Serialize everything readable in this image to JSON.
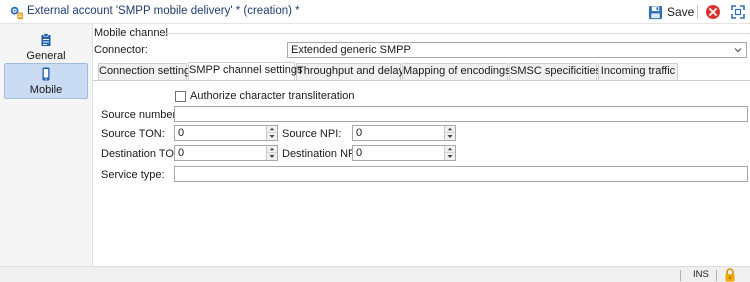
{
  "window": {
    "title": "External account 'SMPP mobile delivery' * (creation) *",
    "save_label": "Save",
    "icons": [
      "app-gear-icon",
      "save-disk-icon",
      "close-circle-icon",
      "expand-icon"
    ],
    "accent_color": "#1f3d73"
  },
  "sidebar": {
    "items": [
      {
        "label": "General",
        "icon": "document-icon",
        "selected": false
      },
      {
        "label": "Mobile",
        "icon": "mobile-phone-icon",
        "selected": true
      }
    ],
    "selected_bg": "#c9dcf3"
  },
  "main": {
    "group_title": "Mobile channel",
    "connector_label": "Connector:",
    "connector_value": "Extended generic SMPP",
    "tabs": [
      {
        "label": "Connection settings",
        "active": false
      },
      {
        "label": "SMPP channel settings",
        "active": true
      },
      {
        "label": "Throughput and delays",
        "active": false
      },
      {
        "label": "Mapping of encodings",
        "active": false
      },
      {
        "label": "SMSC specificities",
        "active": false
      },
      {
        "label": "Incoming traffic",
        "active": false
      }
    ]
  },
  "panel": {
    "authorize_label": "Authorize character transliteration",
    "authorize_checked": false,
    "source_number_label": "Source number:",
    "source_number_value": "",
    "source_ton_label": "Source TON:",
    "source_ton_value": "0",
    "source_npi_label": "Source NPI:",
    "source_npi_value": "0",
    "destination_ton_label": "Destination TON:",
    "destination_ton_value": "0",
    "destination_npi_label": "Destination NPI:",
    "destination_npi_value": "0",
    "service_type_label": "Service type:",
    "service_type_value": ""
  },
  "statusbar": {
    "ins_label": "INS",
    "lock_icon": "lock-icon"
  }
}
